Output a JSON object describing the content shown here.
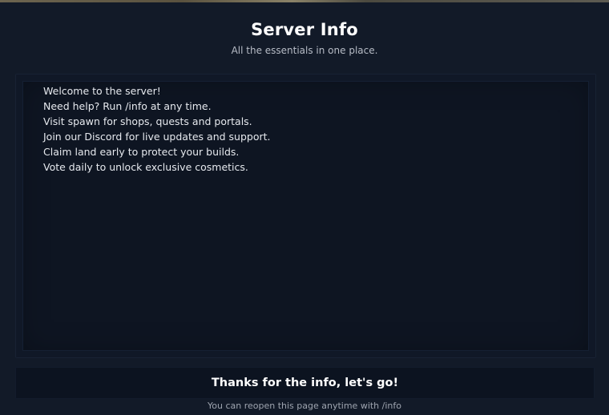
{
  "dialog": {
    "title": "Server Info",
    "subtitle": "All the essentials in one place.",
    "lines": [
      "Welcome to the server!",
      "Need help? Run /info at any time.",
      "Visit spawn for shops, quests and portals.",
      "Join our Discord for live updates and support.",
      "Claim land early to protect your builds.",
      "Vote daily to unlock exclusive cosmetics."
    ],
    "confirm_label": "Thanks for the info, let's go!",
    "footer_hint": "You can reopen this page anytime with /info"
  },
  "colors": {
    "background": "#121a28",
    "text": "#ffffff",
    "muted_text": "#b7bcc6"
  }
}
